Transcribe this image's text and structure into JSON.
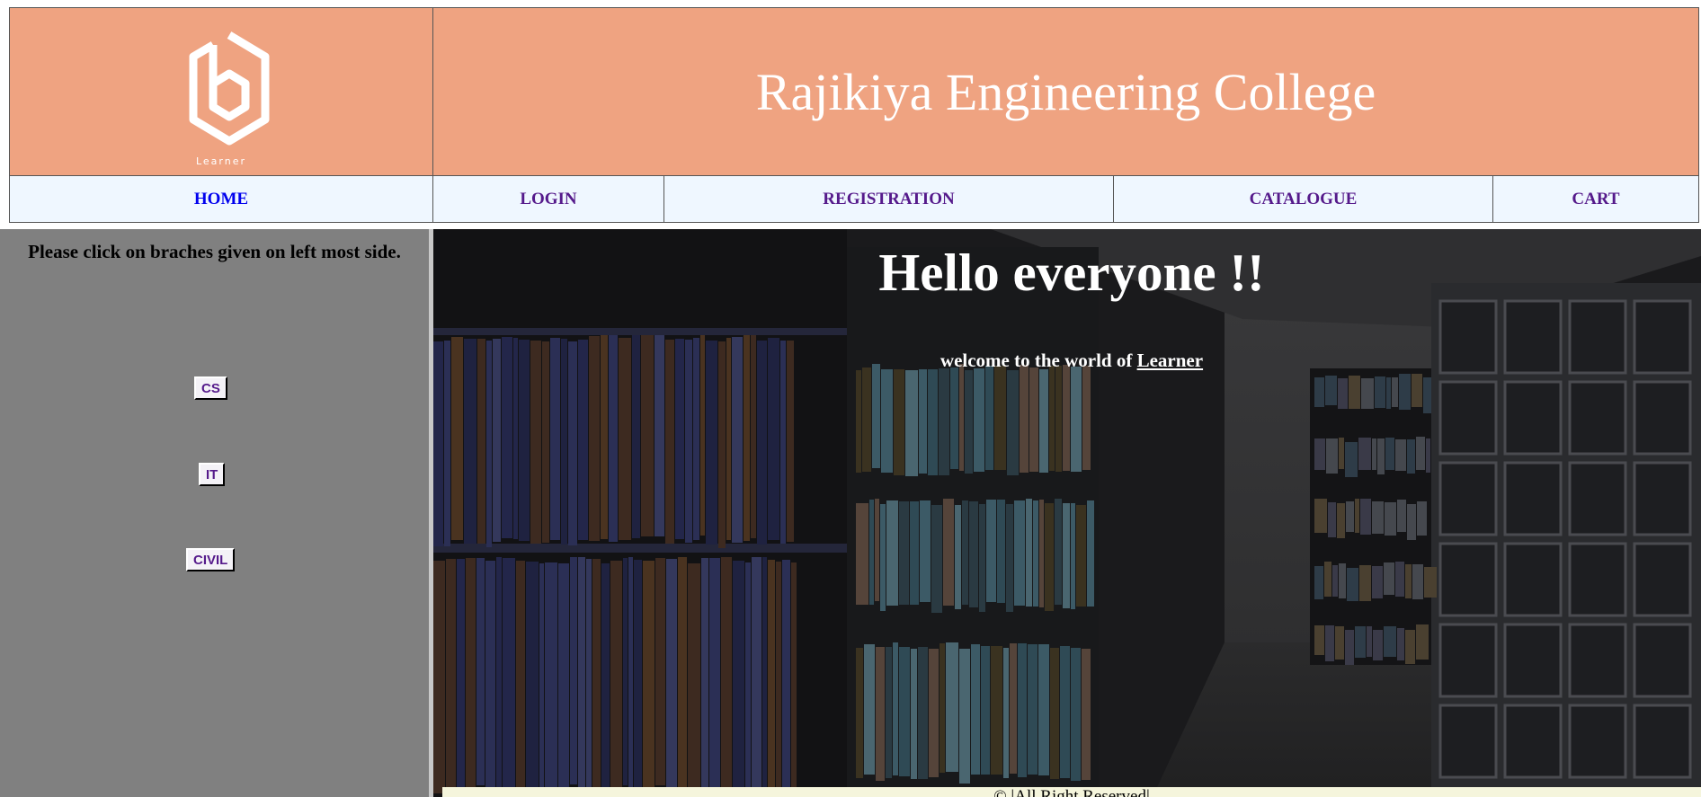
{
  "header": {
    "logo_text": "Learner",
    "title": "Rajikiya Engineering College",
    "brand_color": "#efa381"
  },
  "nav": {
    "items": [
      {
        "label": "HOME"
      },
      {
        "label": "LOGIN"
      },
      {
        "label": "REGISTRATION"
      },
      {
        "label": "CATALOGUE"
      },
      {
        "label": "CART"
      }
    ]
  },
  "sidebar": {
    "instruction": "Please click on braches given on left most side.",
    "branches": [
      {
        "label": "CS"
      },
      {
        "label": "IT"
      },
      {
        "label": "CIVIL"
      }
    ]
  },
  "hero": {
    "heading": "Hello everyone !!",
    "welcome_prefix": "welcome to the world of ",
    "welcome_link": "Learner",
    "background_icon": "library-bookshelves-photo"
  },
  "footer": {
    "text": "© |All Right Reserved|"
  }
}
